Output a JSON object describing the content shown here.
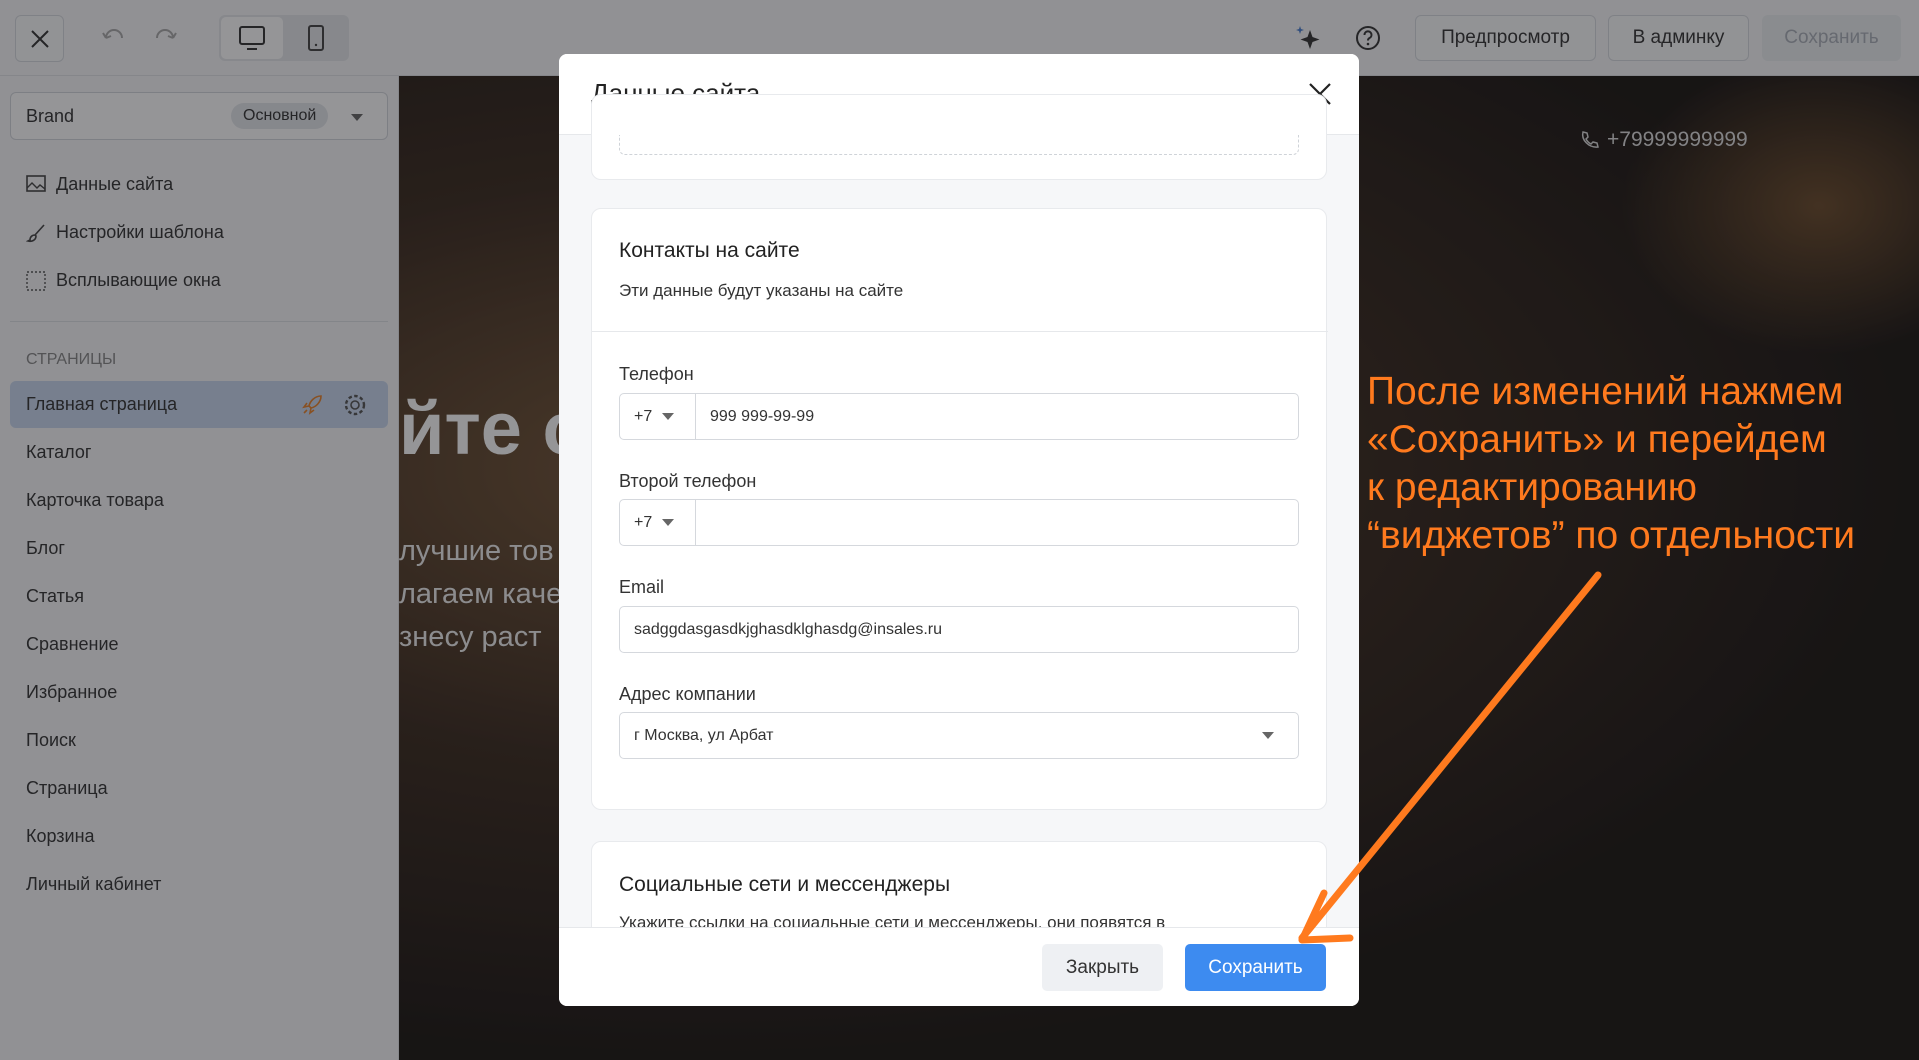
{
  "topbar": {
    "preview": "Предпросмотр",
    "admin": "В админку",
    "save": "Сохранить"
  },
  "sidebar": {
    "brand": "Brand",
    "brand_badge": "Основной",
    "settings": [
      {
        "label": "Данные сайта"
      },
      {
        "label": "Настройки шаблона"
      },
      {
        "label": "Всплывающие окна"
      }
    ],
    "pages_heading": "СТРАНИЦЫ",
    "pages": [
      {
        "label": "Главная страница"
      },
      {
        "label": "Каталог"
      },
      {
        "label": "Карточка товара"
      },
      {
        "label": "Блог"
      },
      {
        "label": "Статья"
      },
      {
        "label": "Сравнение"
      },
      {
        "label": "Избранное"
      },
      {
        "label": "Поиск"
      },
      {
        "label": "Страница"
      },
      {
        "label": "Корзина"
      },
      {
        "label": "Личный кабинет"
      }
    ]
  },
  "hero": {
    "phone": "+79999999999",
    "headline": "йте с",
    "line1": "лучшие тов",
    "line2": "лагаем каче",
    "line3": "знесу раст"
  },
  "modal": {
    "title": "Данные сайта",
    "contacts": {
      "title": "Контакты на сайте",
      "subtitle": "Эти данные будут указаны на сайте",
      "phone_label": "Телефон",
      "phone_code": "+7",
      "phone_value": "999 999-99-99",
      "phone2_label": "Второй телефон",
      "phone2_code": "+7",
      "phone2_value": "",
      "email_label": "Email",
      "email_value": "sadggdasgasdkjghasdklghasdg@insales.ru",
      "address_label": "Адрес компании",
      "address_value": "г Москва, ул Арбат"
    },
    "social": {
      "title": "Социальные сети и мессенджеры",
      "subtitle": "Укажите ссылки на социальные сети и мессенджеры, они появятся в"
    },
    "close": "Закрыть",
    "save": "Сохранить"
  },
  "annotation": {
    "lines": [
      "После изменений нажмем",
      "«Сохранить» и перейдем",
      "к редактированию",
      "“виджетов” по отдельности"
    ]
  },
  "colors": {
    "accent": "#3d8bf0",
    "annotation": "#ff7a1e"
  }
}
